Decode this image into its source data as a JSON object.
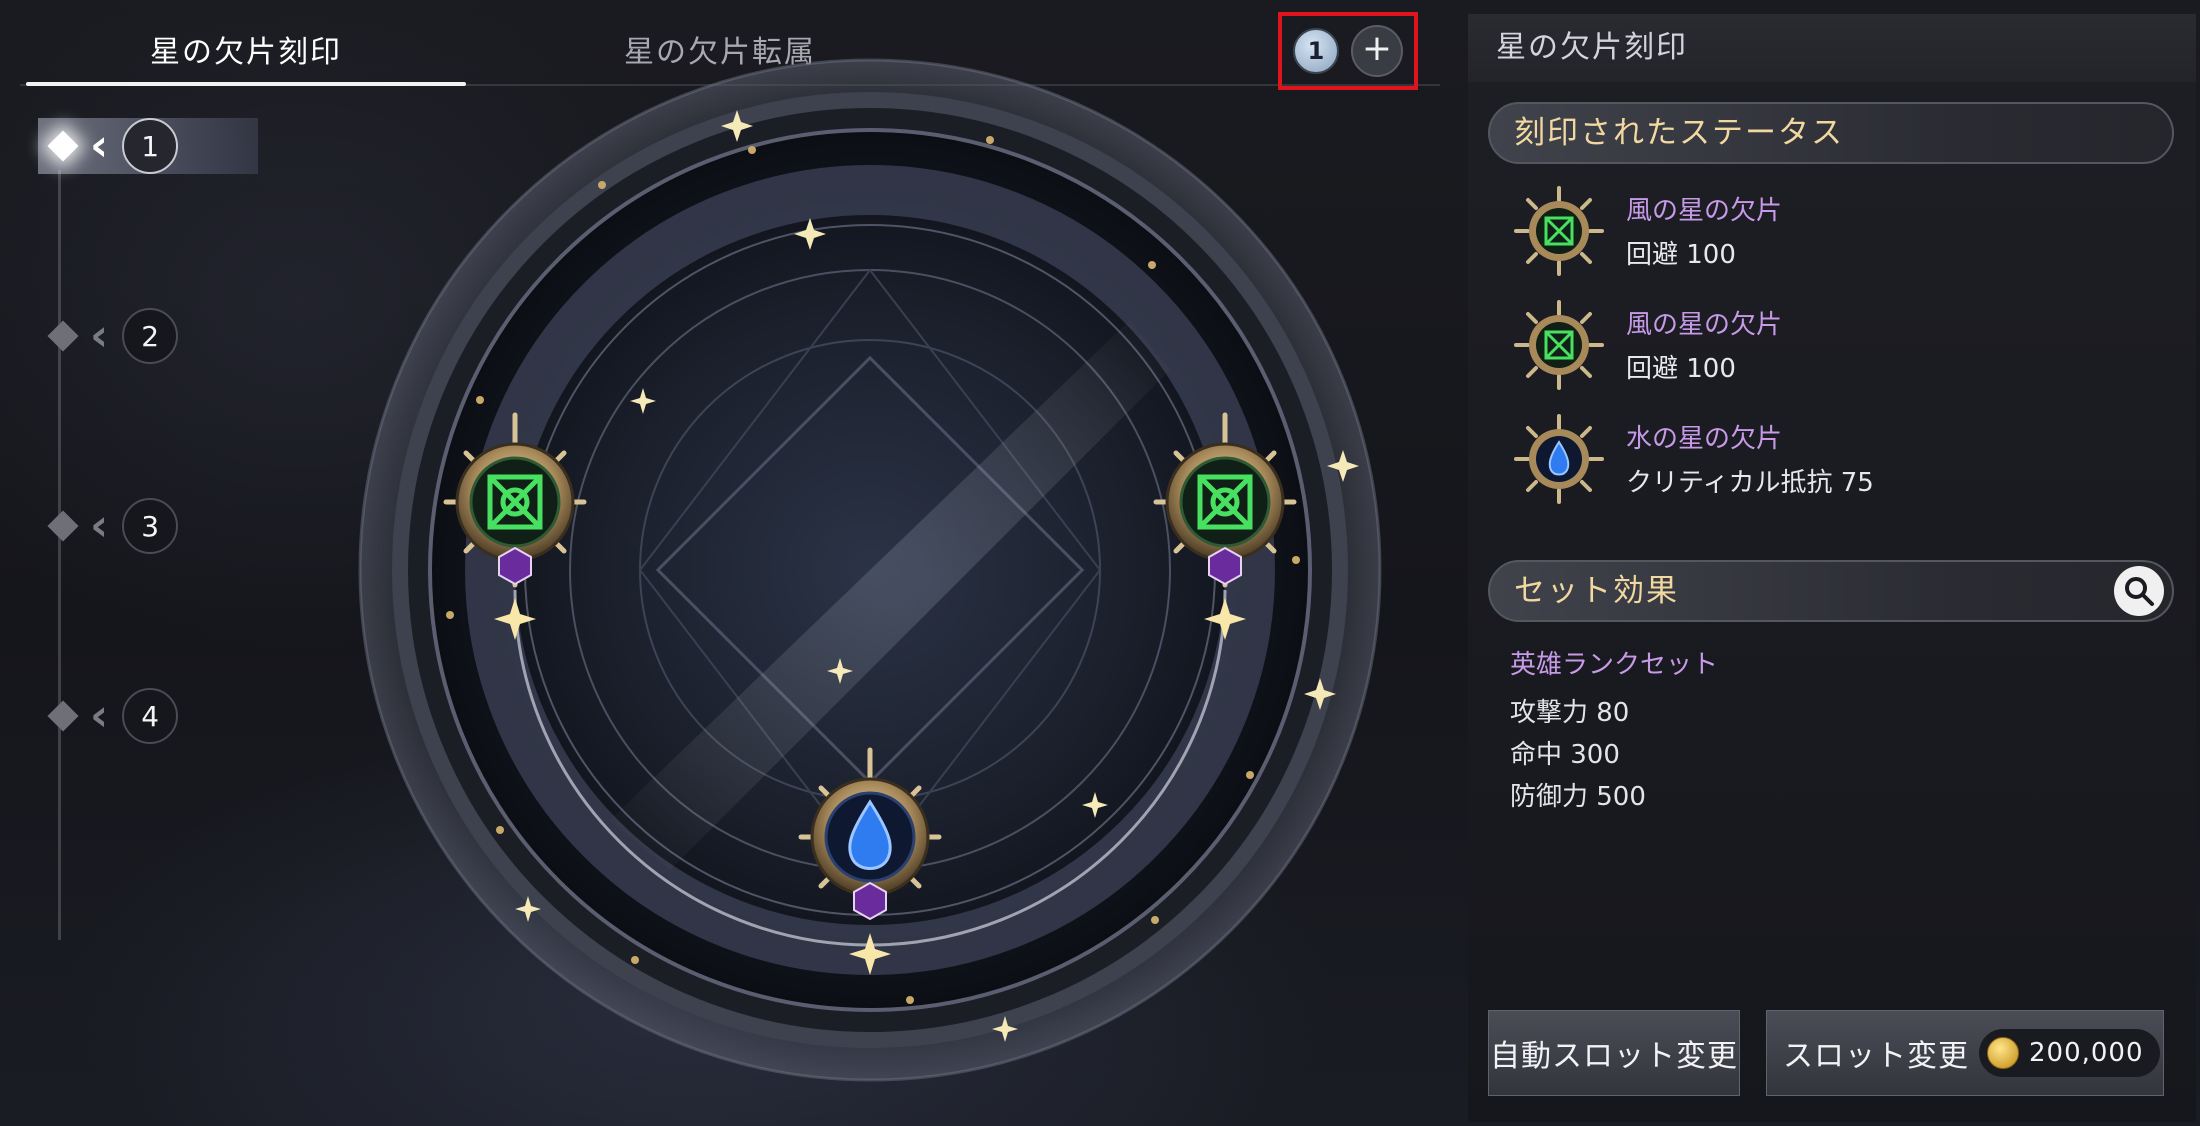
{
  "tabs": [
    {
      "label": "星の欠片刻印",
      "active": true
    },
    {
      "label": "星の欠片転属",
      "active": false
    }
  ],
  "page_counter": {
    "current": "1",
    "add_icon": "plus-icon"
  },
  "slots": [
    {
      "number": "1",
      "active": true
    },
    {
      "number": "2",
      "active": false
    },
    {
      "number": "3",
      "active": false
    },
    {
      "number": "4",
      "active": false
    }
  ],
  "panel": {
    "title": "星の欠片刻印",
    "engraved_header": "刻印されたステータス",
    "engraved": [
      {
        "name": "風の星の欠片",
        "stat": "回避 100",
        "element": "wind"
      },
      {
        "name": "風の星の欠片",
        "stat": "回避 100",
        "element": "wind"
      },
      {
        "name": "水の星の欠片",
        "stat": "クリティカル抵抗 75",
        "element": "water"
      }
    ],
    "set_header": "セット効果",
    "set_name": "英雄ランクセット",
    "set_effects": [
      "攻撃力 80",
      "命中 300",
      "防御力 500"
    ],
    "auto_button": "自動スロット変更",
    "slot_button": "スロット変更",
    "cost": "200,000"
  },
  "colors": {
    "highlight": "#e0141c",
    "accent_gold": "#f1d7a0",
    "shard_name": "#c79ae8",
    "wind_green": "#3fdc5a",
    "water_blue": "#3a8cff"
  }
}
